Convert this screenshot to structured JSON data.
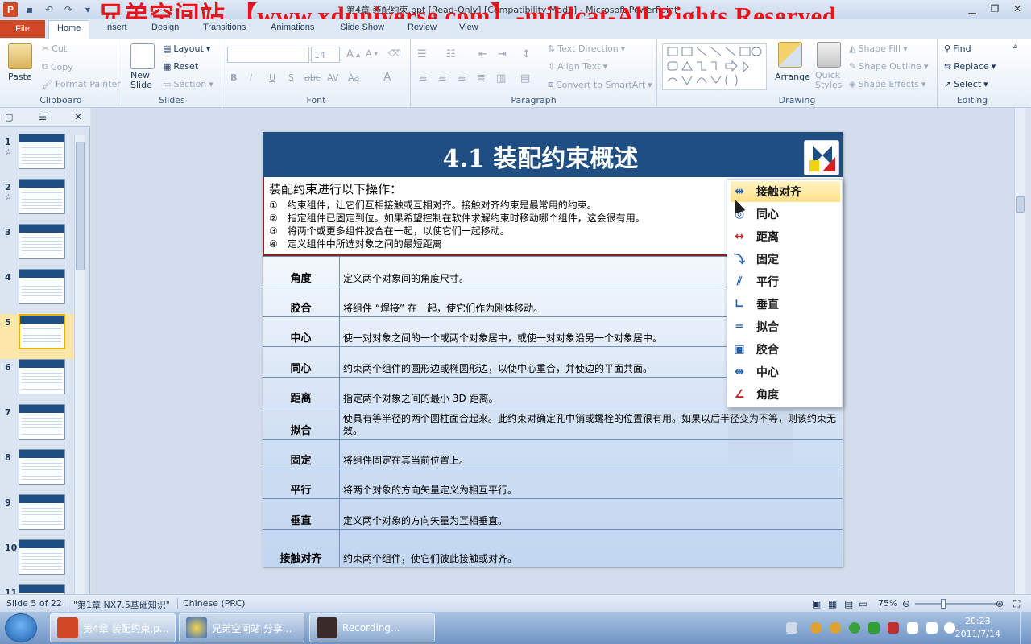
{
  "window": {
    "title": "第4章 装配约束.ppt [Read-Only] [Compatibility Mode] - Microsoft PowerPoint",
    "overlay": "兄弟空间站 【www.xduniverse.com】-mildcat-All Rights Reserved"
  },
  "ribbon_tabs": [
    "File",
    "Home",
    "Insert",
    "Design",
    "Transitions",
    "Animations",
    "Slide Show",
    "Review",
    "View"
  ],
  "ribbon": {
    "clipboard": {
      "label": "Clipboard",
      "paste": "Paste",
      "cut": "Cut",
      "copy": "Copy",
      "format_painter": "Format Painter"
    },
    "slides": {
      "label": "Slides",
      "new_slide": "New Slide",
      "layout": "Layout",
      "reset": "Reset",
      "section": "Section"
    },
    "font": {
      "label": "Font",
      "size": "14"
    },
    "paragraph": {
      "label": "Paragraph",
      "text_direction": "Text Direction",
      "align_text": "Align Text",
      "convert_smartart": "Convert to SmartArt"
    },
    "drawing": {
      "label": "Drawing",
      "arrange": "Arrange",
      "quick_styles": "Quick Styles",
      "shape_fill": "Shape Fill",
      "shape_outline": "Shape Outline",
      "shape_effects": "Shape Effects"
    },
    "editing": {
      "label": "Editing",
      "find": "Find",
      "replace": "Replace",
      "select": "Select"
    }
  },
  "thumbnails": [
    {
      "num": "1",
      "star": "☆"
    },
    {
      "num": "2",
      "star": "☆"
    },
    {
      "num": "3",
      "star": ""
    },
    {
      "num": "4",
      "star": ""
    },
    {
      "num": "5",
      "star": "",
      "selected": true
    },
    {
      "num": "6",
      "star": ""
    },
    {
      "num": "7",
      "star": ""
    },
    {
      "num": "8",
      "star": ""
    },
    {
      "num": "9",
      "star": ""
    },
    {
      "num": "10",
      "star": ""
    },
    {
      "num": "11",
      "star": ""
    }
  ],
  "slide": {
    "title": "4.1 装配约束概述",
    "intro_heading": "装配约束进行以下操作：",
    "intro_lines": [
      "①　约束组件，让它们互相接触或互相对齐。接触对齐约束是最常用的约束。",
      "②　指定组件已固定到位。如果希望控制在软件求解约束时移动哪个组件，这会很有用。",
      "③　将两个或更多组件胶合在一起，以使它们一起移动。",
      "④　定义组件中所选对象之间的最短距离"
    ],
    "rows": [
      {
        "name": "角度",
        "desc": "定义两个对象间的角度尺寸。"
      },
      {
        "name": "胶合",
        "desc": "将组件 “焊接” 在一起，使它们作为刚体移动。"
      },
      {
        "name": "中心",
        "desc": "使一对对象之间的一个或两个对象居中，或使一对对象沿另一个对象居中。"
      },
      {
        "name": "同心",
        "desc": "约束两个组件的圆形边或椭圆形边，以使中心重合，并使边的平面共面。"
      },
      {
        "name": "距离",
        "desc": "指定两个对象之间的最小 3D 距离。"
      },
      {
        "name": "拟合",
        "desc": "使具有等半径的两个圆柱面合起来。此约束对确定孔中销或螺栓的位置很有用。如果以后半径变为不等，则该约束无效。"
      },
      {
        "name": "固定",
        "desc": "将组件固定在其当前位置上。"
      },
      {
        "name": "平行",
        "desc": "将两个对象的方向矢量定义为相互平行。"
      },
      {
        "name": "垂直",
        "desc": "定义两个对象的方向矢量为互相垂直。"
      },
      {
        "name": "接触对齐",
        "desc": "约束两个组件，使它们彼此接触或对齐。"
      }
    ]
  },
  "popup_menu": [
    {
      "label": "接触对齐",
      "icon": "touch-align-icon",
      "glyph": "⇹",
      "color": "#1f5fb0"
    },
    {
      "label": "同心",
      "icon": "concentric-icon",
      "glyph": "◎",
      "color": "#1f5fb0"
    },
    {
      "label": "距离",
      "icon": "distance-icon",
      "glyph": "↔",
      "color": "#c02020"
    },
    {
      "label": "固定",
      "icon": "fix-icon",
      "glyph": "⤵",
      "color": "#1f5fb0"
    },
    {
      "label": "平行",
      "icon": "parallel-icon",
      "glyph": "⫽",
      "color": "#1f5fb0"
    },
    {
      "label": "垂直",
      "icon": "perpendicular-icon",
      "glyph": "∟",
      "color": "#1f5fb0"
    },
    {
      "label": "拟合",
      "icon": "fit-icon",
      "glyph": "═",
      "color": "#1f5fb0"
    },
    {
      "label": "胶合",
      "icon": "bond-icon",
      "glyph": "▣",
      "color": "#1f5fb0"
    },
    {
      "label": "中心",
      "icon": "center-icon",
      "glyph": "⇼",
      "color": "#1f5fb0"
    },
    {
      "label": "角度",
      "icon": "angle-icon",
      "glyph": "∠",
      "color": "#c02020"
    }
  ],
  "status": {
    "slide": "Slide 5 of 22",
    "theme": "\"第1章 NX7.5基础知识\"",
    "language": "Chinese (PRC)",
    "zoom": "75%"
  },
  "taskbar": {
    "items": [
      "第4章 装配约束.p...",
      "兄弟空间站 分享...",
      "Recording..."
    ],
    "time": "20:23",
    "date": "2011/7/14"
  },
  "colors": {
    "accent": "#d24726",
    "slide_header": "#1f4f82",
    "overlay_text": "#e8141b"
  }
}
